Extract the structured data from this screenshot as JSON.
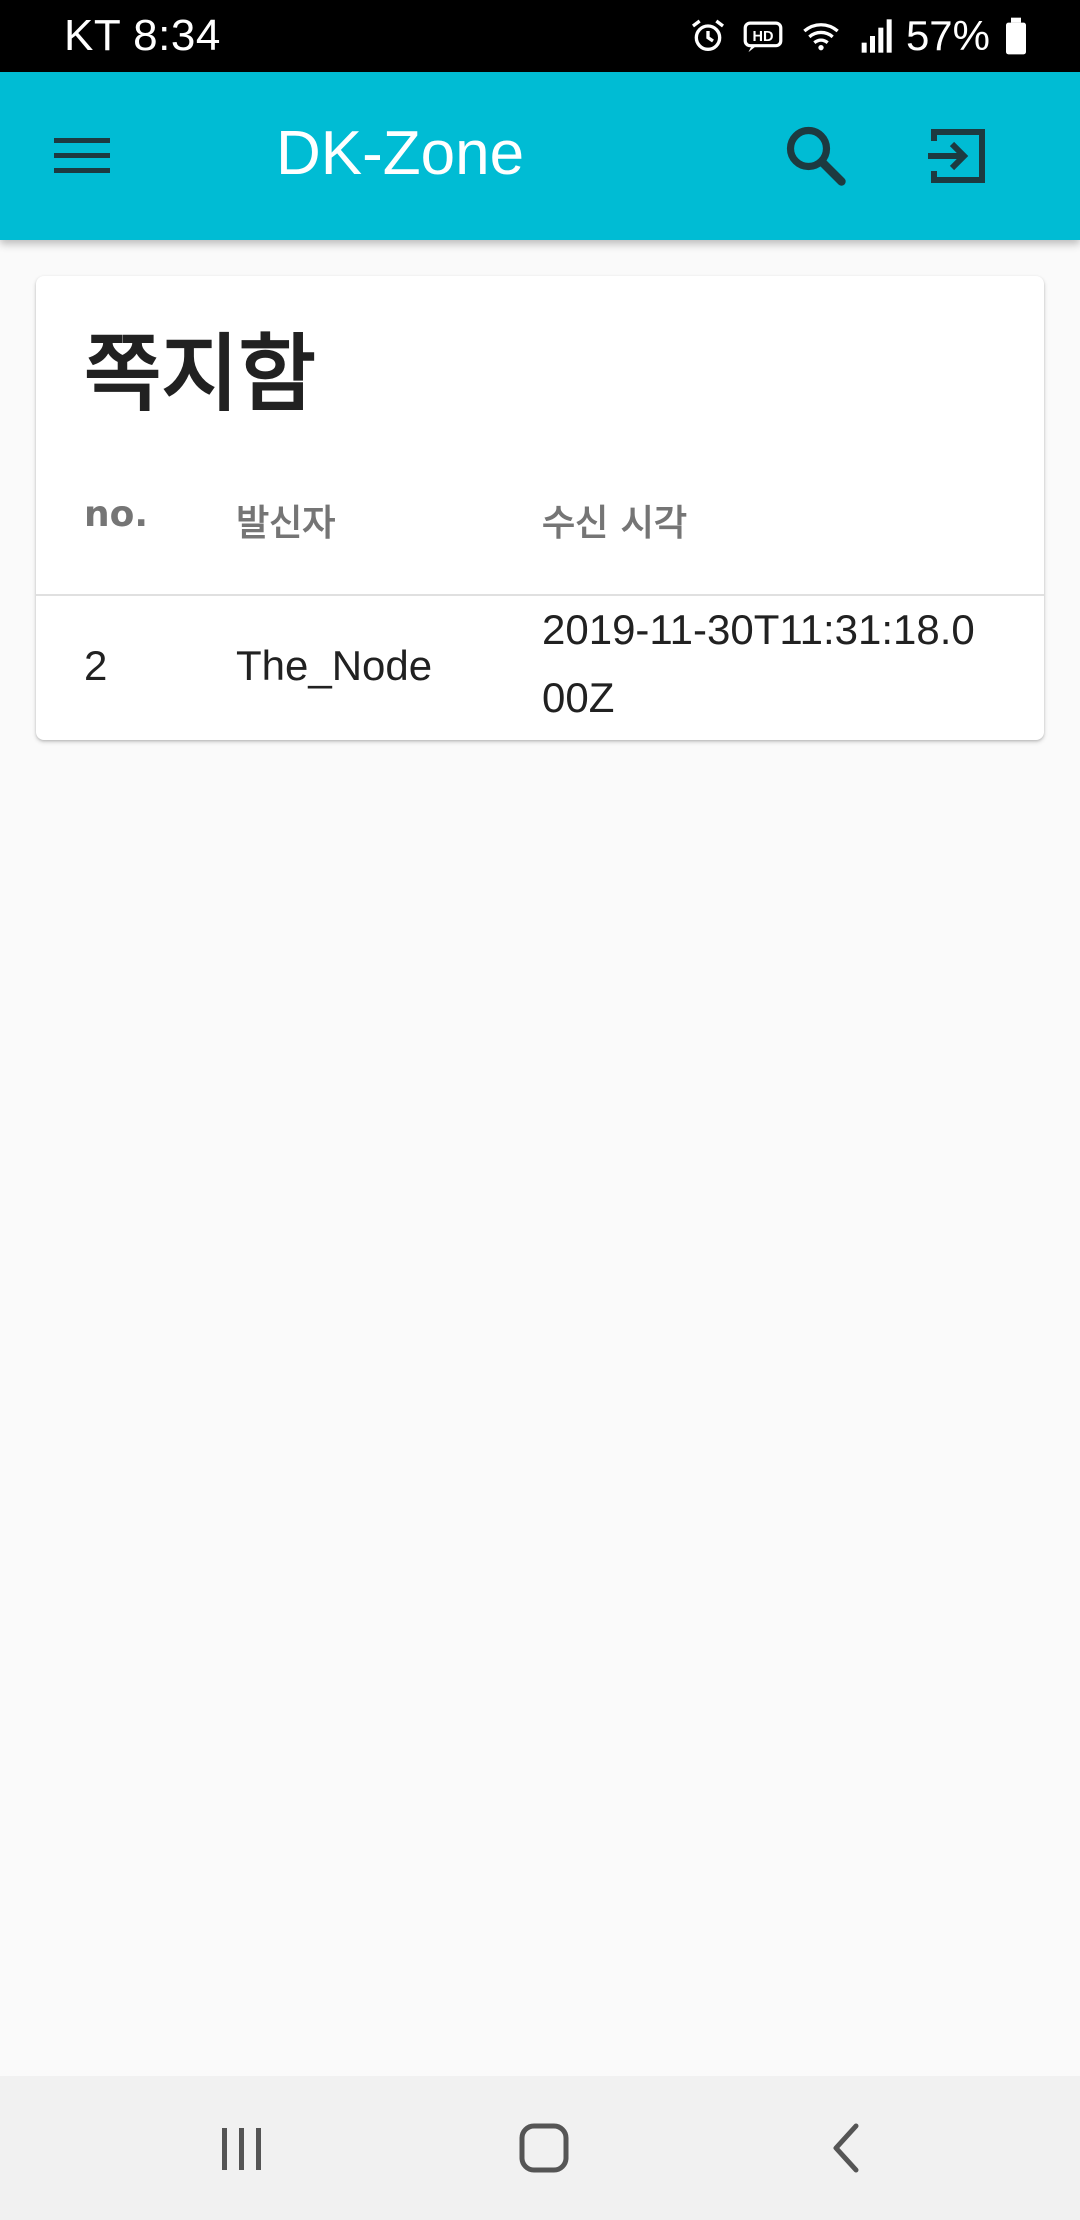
{
  "status_bar": {
    "carrier_time": "KT 8:34",
    "battery": "57%",
    "icons": [
      "alarm-icon",
      "hd-voice-icon",
      "wifi-icon",
      "signal-icon",
      "battery-icon"
    ]
  },
  "app_bar": {
    "title": "DK-Zone",
    "icons": [
      "menu-icon",
      "search-icon",
      "logout-icon"
    ],
    "color": "#00bcd4"
  },
  "inbox": {
    "title": "쪽지함",
    "columns": [
      "no.",
      "발신자",
      "수신 시각"
    ],
    "rows": [
      {
        "no": "2",
        "sender": "The_Node",
        "received_at": "2019-11-30T11:31:18.000Z"
      }
    ]
  },
  "nav_bar": {
    "icons": [
      "recents-icon",
      "home-icon",
      "back-icon"
    ]
  }
}
